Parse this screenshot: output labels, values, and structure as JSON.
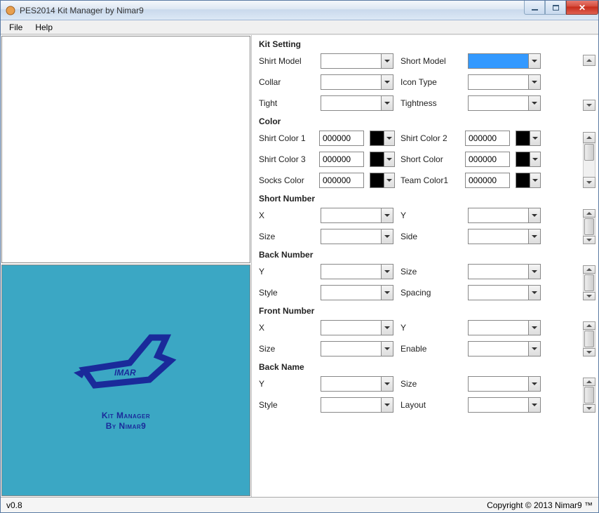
{
  "window": {
    "title": "PES2014 Kit Manager by Nimar9"
  },
  "menu": {
    "file": "File",
    "help": "Help"
  },
  "logo": {
    "line1": "Kit Manager",
    "line2": "By Nimar9"
  },
  "kit_setting": {
    "title": "Kit Setting",
    "shirt_model": "Shirt Model",
    "short_model": "Short Model",
    "collar": "Collar",
    "icon_type": "Icon Type",
    "tight": "Tight",
    "tightness": "Tightness"
  },
  "color": {
    "title": "Color",
    "shirt1": "Shirt Color 1",
    "shirt2": "Shirt Color 2",
    "shirt3": "Shirt Color 3",
    "short": "Short Color",
    "socks": "Socks Color",
    "team1": "Team Color1",
    "hex": "000000"
  },
  "short_number": {
    "title": "Short Number",
    "x": "X",
    "y": "Y",
    "size": "Size",
    "side": "Side"
  },
  "back_number": {
    "title": "Back Number",
    "y": "Y",
    "size": "Size",
    "style": "Style",
    "spacing": "Spacing"
  },
  "front_number": {
    "title": "Front Number",
    "x": "X",
    "y": "Y",
    "size": "Size",
    "enable": "Enable"
  },
  "back_name": {
    "title": "Back Name",
    "y": "Y",
    "size": "Size",
    "style": "Style",
    "layout": "Layout"
  },
  "status": {
    "version": "v0.8",
    "copyright": "Copyright © 2013 Nimar9 ™"
  }
}
